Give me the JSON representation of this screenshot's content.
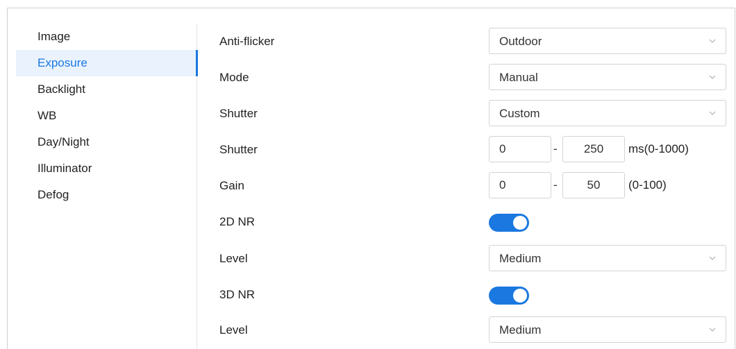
{
  "sidebar": {
    "items": [
      {
        "label": "Image",
        "active": false
      },
      {
        "label": "Exposure",
        "active": true
      },
      {
        "label": "Backlight",
        "active": false
      },
      {
        "label": "WB",
        "active": false
      },
      {
        "label": "Day/Night",
        "active": false
      },
      {
        "label": "Illuminator",
        "active": false
      },
      {
        "label": "Defog",
        "active": false
      }
    ]
  },
  "form": {
    "anti_flicker": {
      "label": "Anti-flicker",
      "value": "Outdoor"
    },
    "mode": {
      "label": "Mode",
      "value": "Manual"
    },
    "shutter_mode": {
      "label": "Shutter",
      "value": "Custom"
    },
    "shutter_range": {
      "label": "Shutter",
      "min": "0",
      "separator": "-",
      "max": "250",
      "unit": "ms(0-1000)"
    },
    "gain": {
      "label": "Gain",
      "min": "0",
      "separator": "-",
      "max": "50",
      "unit": "(0-100)"
    },
    "nr2d": {
      "label": "2D NR",
      "enabled": true
    },
    "nr2d_level": {
      "label": "Level",
      "value": "Medium"
    },
    "nr3d": {
      "label": "3D NR",
      "enabled": true
    },
    "nr3d_level": {
      "label": "Level",
      "value": "Medium"
    }
  },
  "colors": {
    "accent": "#1a78e0",
    "active_bg": "#eaf3fd"
  },
  "icons": {
    "dropdown": "chevron-down-icon"
  }
}
